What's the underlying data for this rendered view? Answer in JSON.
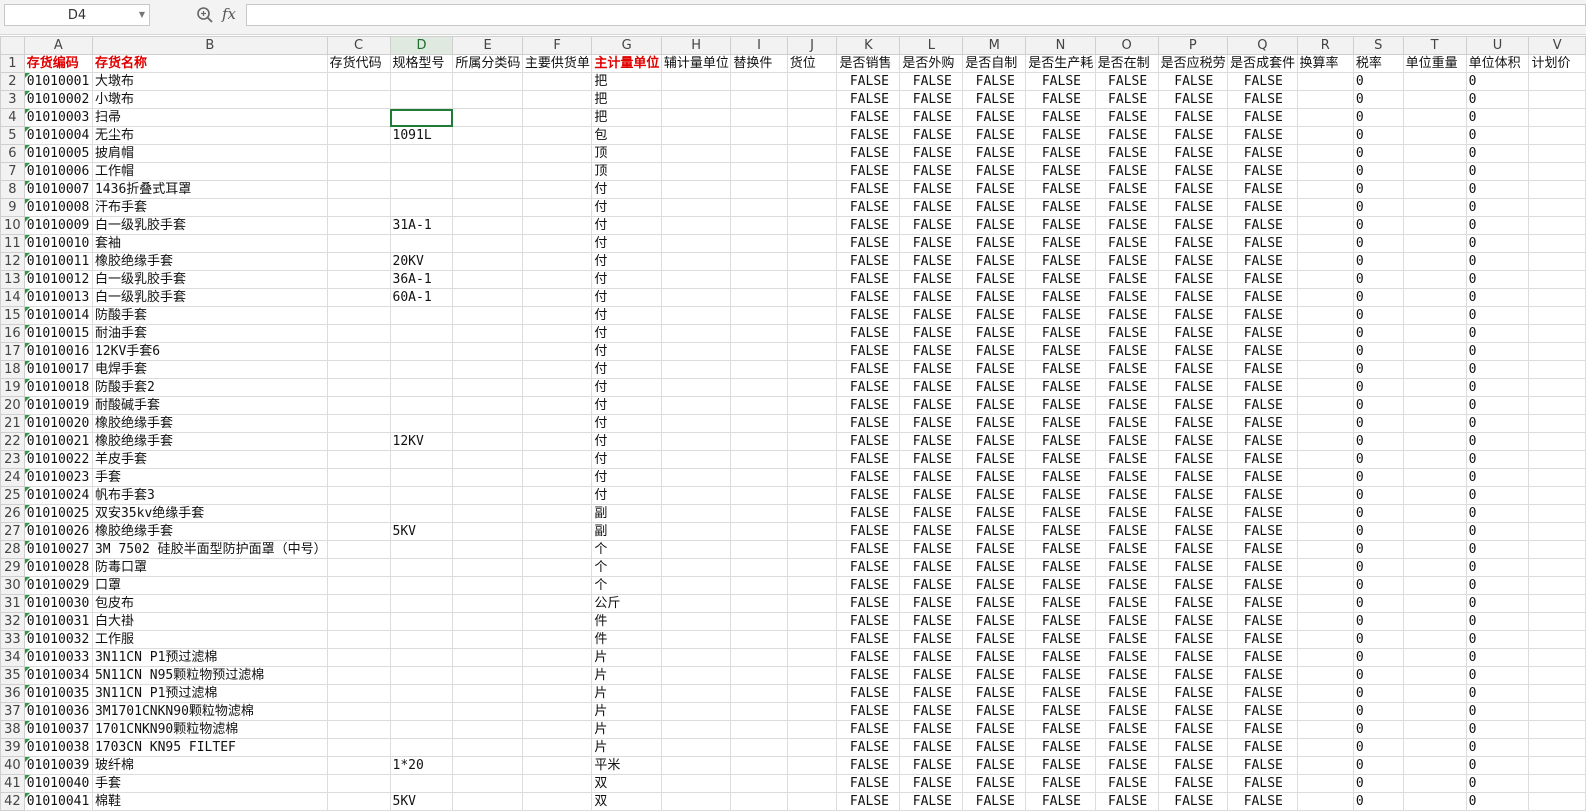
{
  "formula_bar": {
    "name_box": "D4",
    "fx": "fx",
    "formula": ""
  },
  "colors": {
    "header_red": "#e00000",
    "selection_green": "#1f7b35"
  },
  "icons": {
    "zoom": "zoom-magnifier-icon",
    "dropdown": "chevron-down-icon"
  },
  "columns": [
    "A",
    "B",
    "C",
    "D",
    "E",
    "F",
    "G",
    "H",
    "I",
    "J",
    "K",
    "L",
    "M",
    "N",
    "O",
    "P",
    "Q",
    "R",
    "S",
    "T",
    "U",
    "V"
  ],
  "header_row": [
    "存货编码",
    "存货名称",
    "存货代码",
    "规格型号",
    "所属分类码",
    "主要供货单",
    "主计量单位",
    "辅计量单位",
    "替换件",
    "货位",
    "是否销售",
    "是否外购",
    "是否自制",
    "是否生产耗",
    "是否在制",
    "是否应税劳",
    "是否成套件",
    "换算率",
    "税率",
    "单位重量",
    "单位体积",
    "计划价"
  ],
  "rows": [
    {
      "r": "2",
      "code": "01010001",
      "name": "大墩布",
      "spec": "",
      "unit": "把"
    },
    {
      "r": "3",
      "code": "01010002",
      "name": "小墩布",
      "spec": "",
      "unit": "把"
    },
    {
      "r": "4",
      "code": "01010003",
      "name": "扫帚",
      "spec": "",
      "unit": "把"
    },
    {
      "r": "5",
      "code": "01010004",
      "name": "无尘布",
      "spec": "1091L",
      "unit": "包"
    },
    {
      "r": "6",
      "code": "01010005",
      "name": "披肩帽",
      "spec": "",
      "unit": "顶"
    },
    {
      "r": "7",
      "code": "01010006",
      "name": "工作帽",
      "spec": "",
      "unit": "顶"
    },
    {
      "r": "8",
      "code": "01010007",
      "name": "1436折叠式耳罩",
      "spec": "",
      "unit": "付"
    },
    {
      "r": "9",
      "code": "01010008",
      "name": "汗布手套",
      "spec": "",
      "unit": "付"
    },
    {
      "r": "10",
      "code": "01010009",
      "name": "白一级乳胶手套",
      "spec": "31A-1",
      "unit": "付"
    },
    {
      "r": "11",
      "code": "01010010",
      "name": "套袖",
      "spec": "",
      "unit": "付"
    },
    {
      "r": "12",
      "code": "01010011",
      "name": "橡胶绝缘手套",
      "spec": "20KV",
      "unit": "付"
    },
    {
      "r": "13",
      "code": "01010012",
      "name": "白一级乳胶手套",
      "spec": "36A-1",
      "unit": "付"
    },
    {
      "r": "14",
      "code": "01010013",
      "name": "白一级乳胶手套",
      "spec": "60A-1",
      "unit": "付"
    },
    {
      "r": "15",
      "code": "01010014",
      "name": "防酸手套",
      "spec": "",
      "unit": "付"
    },
    {
      "r": "16",
      "code": "01010015",
      "name": "耐油手套",
      "spec": "",
      "unit": "付"
    },
    {
      "r": "17",
      "code": "01010016",
      "name": "12KV手套6",
      "spec": "",
      "unit": "付"
    },
    {
      "r": "18",
      "code": "01010017",
      "name": "电焊手套",
      "spec": "",
      "unit": "付"
    },
    {
      "r": "19",
      "code": "01010018",
      "name": "防酸手套2",
      "spec": "",
      "unit": "付"
    },
    {
      "r": "20",
      "code": "01010019",
      "name": "耐酸碱手套",
      "spec": "",
      "unit": "付"
    },
    {
      "r": "21",
      "code": "01010020",
      "name": "橡胶绝缘手套",
      "spec": "",
      "unit": "付"
    },
    {
      "r": "22",
      "code": "01010021",
      "name": "橡胶绝缘手套",
      "spec": "12KV",
      "unit": "付"
    },
    {
      "r": "23",
      "code": "01010022",
      "name": "羊皮手套",
      "spec": "",
      "unit": "付"
    },
    {
      "r": "24",
      "code": "01010023",
      "name": "手套",
      "spec": "",
      "unit": "付"
    },
    {
      "r": "25",
      "code": "01010024",
      "name": "帆布手套3",
      "spec": "",
      "unit": "付"
    },
    {
      "r": "26",
      "code": "01010025",
      "name": "双安35kv绝缘手套",
      "spec": "",
      "unit": "副"
    },
    {
      "r": "27",
      "code": "01010026",
      "name": "橡胶绝缘手套",
      "spec": "5KV",
      "unit": "副"
    },
    {
      "r": "28",
      "code": "01010027",
      "name": "3M 7502 硅胶半面型防护面罩（中号）",
      "spec": "",
      "unit": "个"
    },
    {
      "r": "29",
      "code": "01010028",
      "name": "防毒口罩",
      "spec": "",
      "unit": "个"
    },
    {
      "r": "30",
      "code": "01010029",
      "name": "口罩",
      "spec": "",
      "unit": "个"
    },
    {
      "r": "31",
      "code": "01010030",
      "name": "包皮布",
      "spec": "",
      "unit": "公斤"
    },
    {
      "r": "32",
      "code": "01010031",
      "name": "白大褂",
      "spec": "",
      "unit": "件"
    },
    {
      "r": "33",
      "code": "01010032",
      "name": "工作服",
      "spec": "",
      "unit": "件"
    },
    {
      "r": "34",
      "code": "01010033",
      "name": "3N11CN  P1预过滤棉",
      "spec": "",
      "unit": "片"
    },
    {
      "r": "35",
      "code": "01010034",
      "name": "5N11CN N95颗粒物预过滤棉",
      "spec": "",
      "unit": "片"
    },
    {
      "r": "36",
      "code": "01010035",
      "name": "3N11CN  P1预过滤棉",
      "spec": "",
      "unit": "片"
    },
    {
      "r": "37",
      "code": "01010036",
      "name": "3M1701CNKN90颗粒物滤棉",
      "spec": "",
      "unit": "片"
    },
    {
      "r": "38",
      "code": "01010037",
      "name": "1701CNKN90颗粒物滤棉",
      "spec": "",
      "unit": "片"
    },
    {
      "r": "39",
      "code": "01010038",
      "name": "1703CN KN95 FILTEF",
      "spec": "",
      "unit": "片"
    },
    {
      "r": "40",
      "code": "01010039",
      "name": "玻纤棉",
      "spec": "1*20",
      "unit": "平米"
    },
    {
      "r": "41",
      "code": "01010040",
      "name": "手套",
      "spec": "",
      "unit": "双"
    },
    {
      "r": "42",
      "code": "01010041",
      "name": "棉鞋",
      "spec": "5KV",
      "unit": "双"
    }
  ],
  "bool_value": "FALSE",
  "zero_value": "0"
}
